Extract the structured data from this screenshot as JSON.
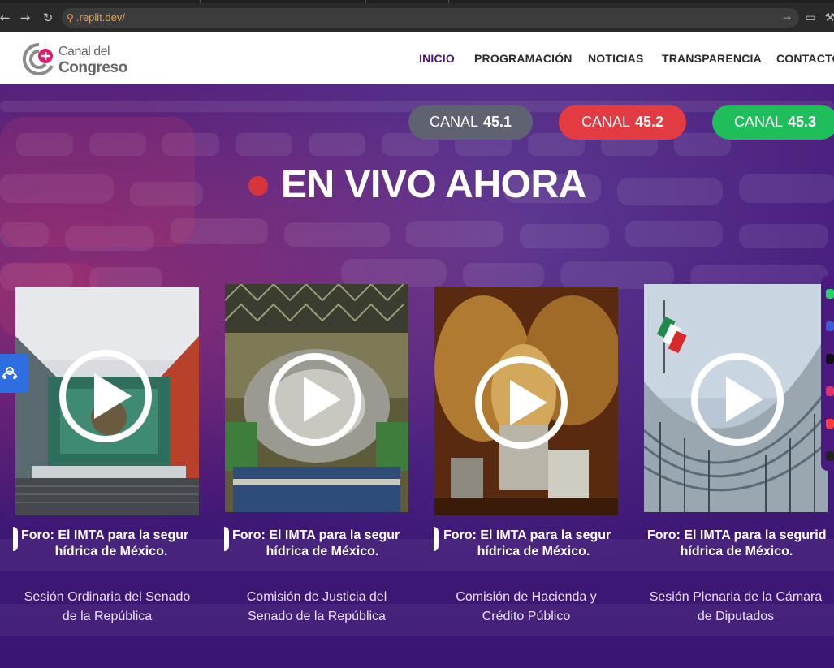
{
  "browser": {
    "url": ".replit.dev/",
    "icons": [
      "back-icon",
      "forward-icon",
      "reload-icon",
      "link-icon",
      "send-icon",
      "monitor-icon",
      "wrench-icon"
    ]
  },
  "header": {
    "logo_line1": "Canal del",
    "logo_line2": "Congreso",
    "nav": [
      "INICIO",
      "PROGRAMACIÓN",
      "NOTICIAS",
      "TRANSPARENCIA",
      "CONTACTO"
    ],
    "active_nav": "INICIO"
  },
  "channels": [
    {
      "label": "CANAL",
      "number": "45.1",
      "color": "#5f6371"
    },
    {
      "label": "CANAL",
      "number": "45.2",
      "color": "#e23b41"
    },
    {
      "label": "CANAL",
      "number": "45.3",
      "color": "#1fbe5a"
    }
  ],
  "live": {
    "title": "EN VIVO AHORA",
    "dot_color": "#d8353a"
  },
  "cards": [
    {
      "ticker_line1": "Foro: El IMTA para la segur",
      "ticker_line2": "hídrica de México.",
      "caption_line1": "Sesión Ordinaria del Senado",
      "caption_line2": "de la República"
    },
    {
      "ticker_line1": "Foro: El IMTA para la segur",
      "ticker_line2": "hídrica de México.",
      "caption_line1": "Comisión de Justicia del",
      "caption_line2": "Senado de la República"
    },
    {
      "ticker_line1": "Foro: El IMTA para la segur",
      "ticker_line2": "hídrica de México.",
      "caption_line1": "Comisión de Hacienda y",
      "caption_line2": "Crédito Público"
    },
    {
      "ticker_line1": "Foro: El IMTA para la segurid",
      "ticker_line2": "hídrica de México.",
      "caption_line1": "Sesión Plenaria de la Cámara",
      "caption_line2": "de Diputados"
    }
  ],
  "colors": {
    "brand_purple": "#4a1277",
    "accessibility_blue": "#2f6ee0",
    "hero_purple": "#43197a"
  }
}
